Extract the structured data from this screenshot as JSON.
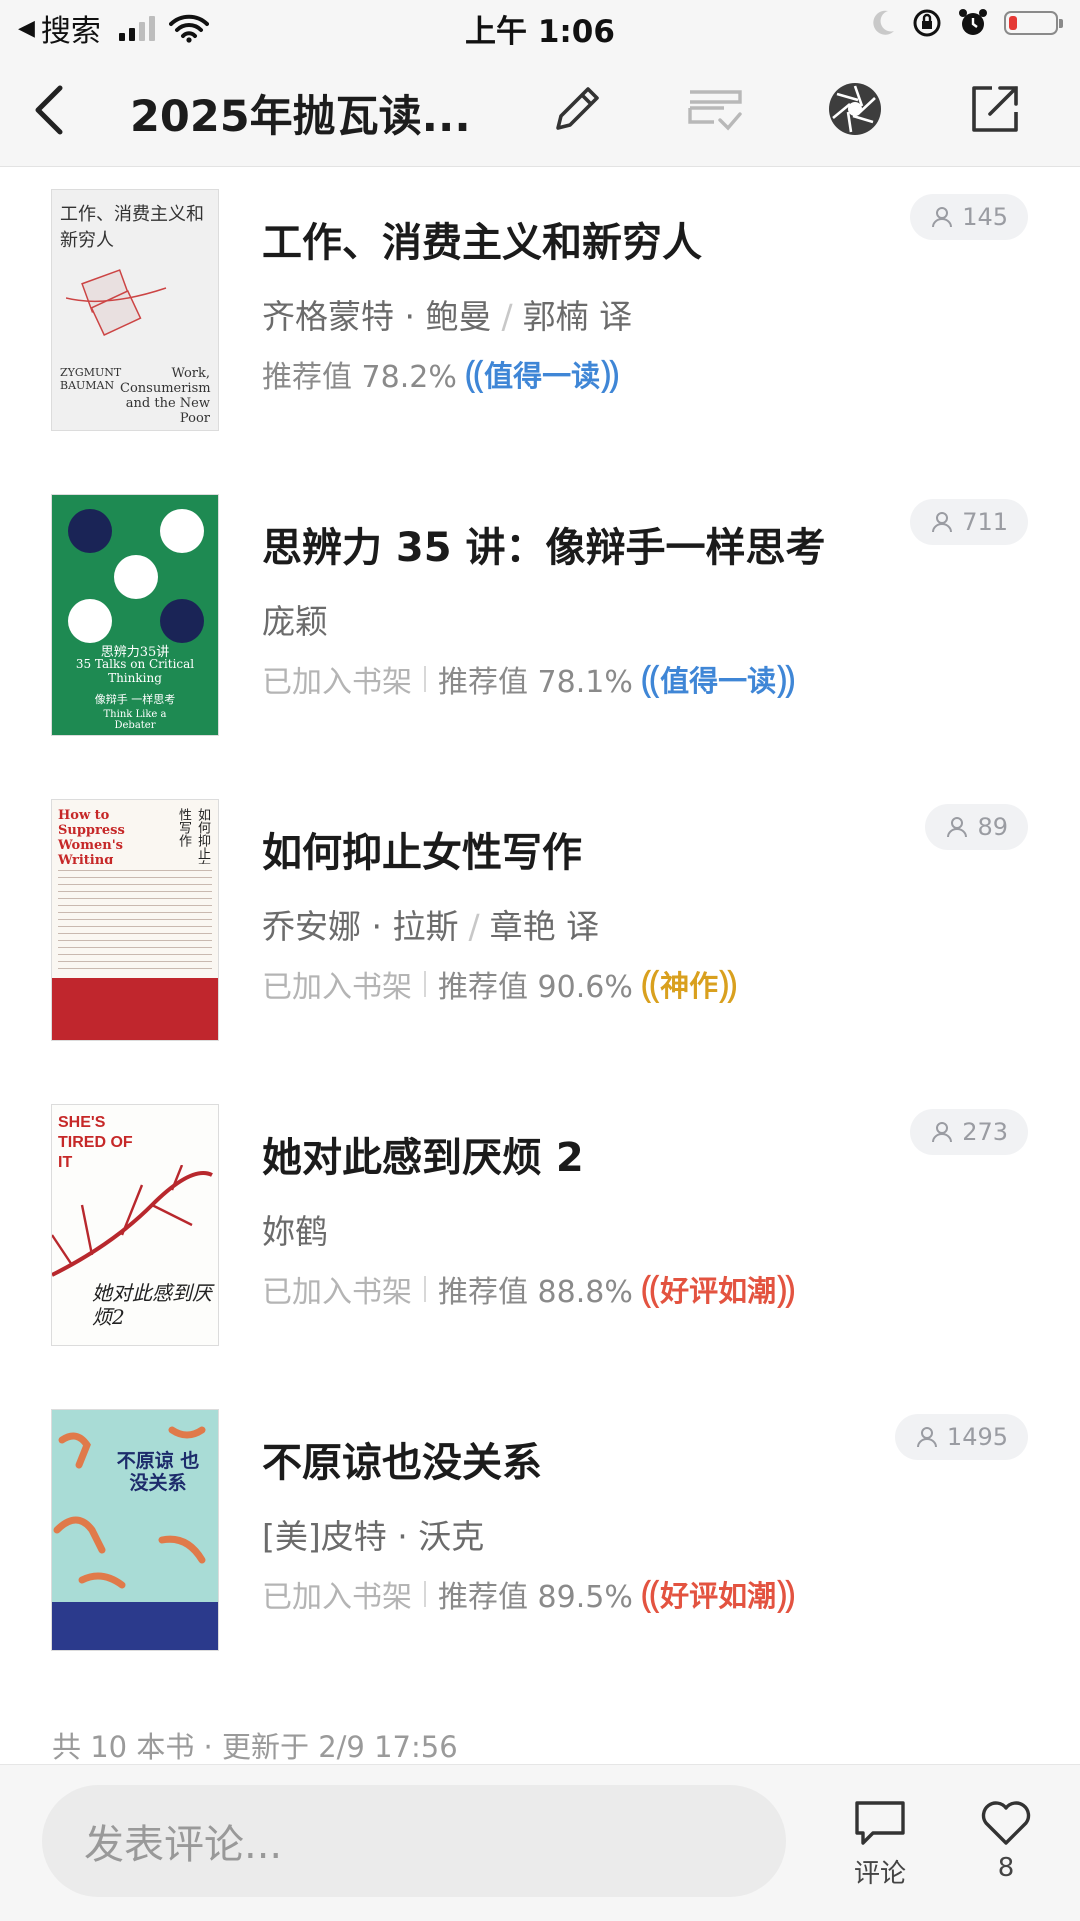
{
  "status_bar": {
    "back_app": "搜索",
    "time": "上午 1:06"
  },
  "nav": {
    "title": "2025年抛瓦读...",
    "icons": [
      "back-chevron-icon",
      "pencil-icon",
      "manage-list-icon",
      "aperture-icon",
      "share-icon"
    ]
  },
  "books": [
    {
      "title": "工作、消费主义和新穷人",
      "author": "齐格蒙特 · 鲍曼",
      "translator": "郭楠 译",
      "shelf": "",
      "rec_label": "推荐值 78.2%",
      "badge": "值得一读",
      "badge_color": "#3f86d6",
      "count": "145",
      "cover": {
        "cn_title": "工作、消费主义和新穷人",
        "en_author": "ZYGMUNT BAUMAN",
        "en_title": "Work, Consumerism and the New Poor"
      }
    },
    {
      "title": "思辨力 35 讲：像辩手一样思考",
      "author": "庞颖",
      "translator": "",
      "shelf": "已加入书架",
      "rec_label": "推荐值 78.1%",
      "badge": "值得一读",
      "badge_color": "#3f86d6",
      "count": "711",
      "cover": {
        "cn_title": "思辨力35讲",
        "en_title": "35 Talks on Critical Thinking",
        "cn_sub": "像辩手 一样思考",
        "en_sub": "Think Like a Debater"
      }
    },
    {
      "title": "如何抑止女性写作",
      "author": "乔安娜 · 拉斯",
      "translator": "章艳 译",
      "shelf": "已加入书架",
      "rec_label": "推荐值 90.6%",
      "badge": "神作",
      "badge_color": "#d9a01e",
      "count": "89",
      "cover": {
        "en_title": "How to Suppress Women's Writing",
        "cn_title": "如何抑止女性写作"
      }
    },
    {
      "title": "她对此感到厌烦 2",
      "author": "妳鹤",
      "translator": "",
      "shelf": "已加入书架",
      "rec_label": "推荐值 88.8%",
      "badge": "好评如潮",
      "badge_color": "#e35340",
      "count": "273",
      "cover": {
        "en_title": "SHE'S TIRED OF IT",
        "cn_title": "她对此感到厌烦2"
      }
    },
    {
      "title": "不原谅也没关系",
      "author": "[美]皮特 · 沃克",
      "translator": "",
      "shelf": "已加入书架",
      "rec_label": "推荐值 89.5%",
      "badge": "好评如潮",
      "badge_color": "#e35340",
      "count": "1495",
      "cover": {
        "cn_title": "不原谅 也没关系"
      }
    }
  ],
  "footer": {
    "info": "共 10 本书 · 更新于 2/9 17:56"
  },
  "bottom_bar": {
    "comment_placeholder": "发表评论...",
    "comment_label": "评论",
    "like_count": "8"
  }
}
